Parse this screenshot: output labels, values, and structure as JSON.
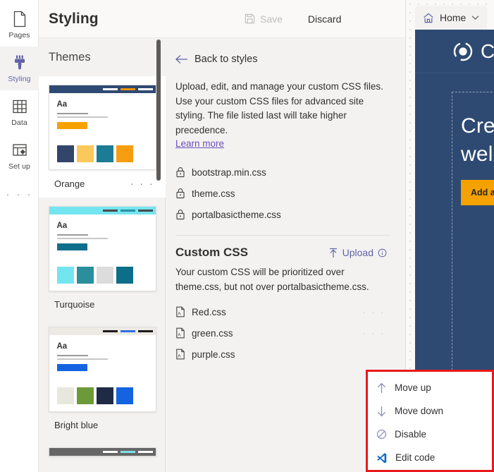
{
  "rail": {
    "items": [
      {
        "label": "Pages",
        "icon": "page-icon",
        "active": false
      },
      {
        "label": "Styling",
        "icon": "paintbrush-icon",
        "active": true
      },
      {
        "label": "Data",
        "icon": "table-grid-icon",
        "active": false
      },
      {
        "label": "Set up",
        "icon": "setup-gear-icon",
        "active": false
      }
    ],
    "overflow": "· · ·"
  },
  "header": {
    "title": "Styling",
    "save_label": "Save",
    "discard_label": "Discard"
  },
  "themes_panel": {
    "title": "Themes",
    "menu_dots": "· · ·",
    "themes": [
      {
        "name": "Orange",
        "selected": true,
        "bar": "#2f4a72",
        "bar_marks": [
          "#ffffff",
          "#f29200",
          "#ffffff"
        ],
        "line1": "#9a9a9a",
        "line2": "#c8c8c8",
        "button": "#f5a100",
        "swatches": [
          "#33456b",
          "#fbc85b",
          "#1d7c95",
          "#f79d10"
        ]
      },
      {
        "name": "Turquoise",
        "selected": false,
        "bar": "#73e5f0",
        "bar_marks": [
          "#4a4a4a",
          "#2b8f9e",
          "#4a4a4a"
        ],
        "line1": "#9a9a9a",
        "line2": "#c8c8c8",
        "button": "#0f6e8c",
        "swatches": [
          "#73e5f0",
          "#2a8e9c",
          "#dcdcdc",
          "#0d6e8a"
        ]
      },
      {
        "name": "Bright blue",
        "selected": false,
        "bar": "#eceae3",
        "bar_marks": [
          "#1b1b1b",
          "#2f6fe4",
          "#1b1b1b"
        ],
        "line1": "#9a9a9a",
        "line2": "#c8c8c8",
        "button": "#1463e0",
        "swatches": [
          "#e8e7dd",
          "#6d9a38",
          "#1f2b44",
          "#1463e0"
        ]
      },
      {
        "name": "",
        "selected": false,
        "bar": "#666666",
        "bar_marks": [
          "#ffffff",
          "#7fe0ea",
          "#ffffff"
        ],
        "line1": "#9a9a9a",
        "line2": "#c8c8c8",
        "button": "#666666",
        "swatches": [
          "#cccccc",
          "#888888",
          "#7fe0ea",
          "#444444"
        ]
      }
    ]
  },
  "main": {
    "back_label": "Back to styles",
    "intro": "Upload, edit, and manage your custom CSS files. Use your custom CSS files for advanced site styling. The file listed last will take higher precedence.",
    "learn_more": "Learn more",
    "locked_files": [
      {
        "name": "bootstrap.min.css",
        "icon": "lock-icon"
      },
      {
        "name": "theme.css",
        "icon": "lock-icon"
      },
      {
        "name": "portalbasictheme.css",
        "icon": "lock-icon"
      }
    ],
    "custom_title": "Custom CSS",
    "upload_label": "Upload",
    "custom_desc": "Your custom CSS will be prioritized over theme.css, but not over portalbasictheme.css.",
    "custom_files": [
      {
        "name": "Red.css",
        "icon": "css-file-icon",
        "dots": "· · ·"
      },
      {
        "name": "green.css",
        "icon": "css-file-icon",
        "dots": "· · ·"
      },
      {
        "name": "purple.css",
        "icon": "css-file-icon",
        "dots": "· · ·"
      }
    ]
  },
  "context_menu": {
    "highlight_color": "#e8191d",
    "items": [
      {
        "label": "Move up",
        "icon": "arrow-up-icon"
      },
      {
        "label": "Move down",
        "icon": "arrow-down-icon"
      },
      {
        "label": "Disable",
        "icon": "block-icon"
      },
      {
        "label": "Edit code",
        "icon": "vscode-icon"
      }
    ]
  },
  "preview": {
    "tab_label": "Home",
    "logo_text": "C",
    "heading": "Cre welc",
    "cta_label": "Add a",
    "canvas_color": "#2e4a72",
    "cta_color": "#f5a100"
  }
}
